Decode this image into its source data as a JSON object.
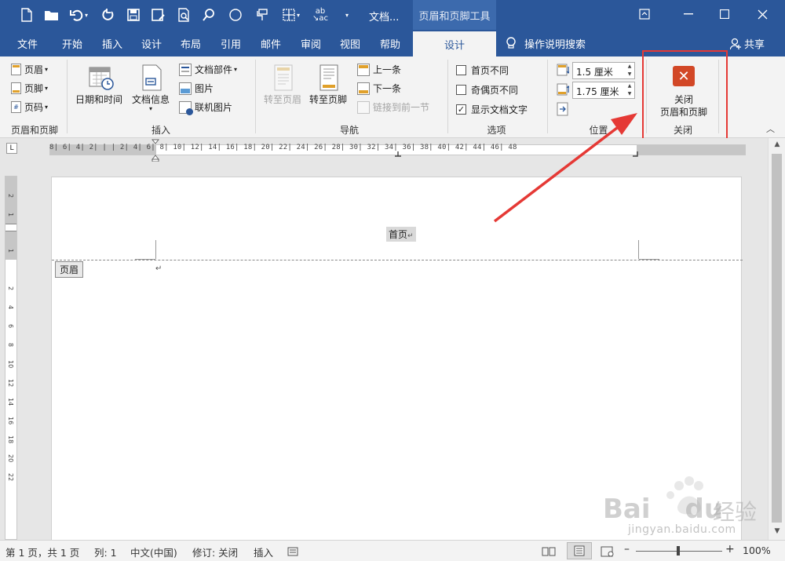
{
  "titlebar": {
    "doc_title": "文档...",
    "tools_title": "页眉和页脚工具",
    "qat_icons": [
      "new-doc-icon",
      "open-icon",
      "undo-icon",
      "redo-icon",
      "save-icon",
      "save-as-icon",
      "print-preview-icon",
      "find-icon",
      "shape-icon",
      "format-painter-icon",
      "table-icon",
      "spelling-icon",
      "customize-icon"
    ]
  },
  "tabs": {
    "items": [
      "文件",
      "开始",
      "插入",
      "设计",
      "布局",
      "引用",
      "邮件",
      "审阅",
      "视图",
      "帮助"
    ],
    "active": "设计",
    "tellme": "操作说明搜索",
    "share": "共享"
  },
  "ribbon": {
    "hf_group": {
      "header": "页眉",
      "footer": "页脚",
      "page_number": "页码",
      "label": "页眉和页脚"
    },
    "insert_group": {
      "date_time": "日期和时间",
      "doc_info": "文档信息",
      "quick_parts": "文档部件",
      "pictures": "图片",
      "online_pictures": "联机图片",
      "label": "插入"
    },
    "nav_group": {
      "goto_header": "转至页眉",
      "goto_footer": "转至页脚",
      "previous": "上一条",
      "next": "下一条",
      "link_previous": "链接到前一节",
      "label": "导航"
    },
    "options_group": {
      "different_first": "首页不同",
      "different_odd_even": "奇偶页不同",
      "show_doc_text": "显示文档文字",
      "label": "选项"
    },
    "position_group": {
      "header_from_top": "1.5 厘米",
      "footer_from_bottom": "1.75 厘米",
      "label": "位置"
    },
    "close_group": {
      "close_line1": "关闭",
      "close_line2": "页眉和页脚",
      "label": "关闭"
    }
  },
  "ruler": {
    "labels": "8| 6| 4| 2| |  | 2| 4| 6| 8| 10| 12| 14| 16| 18| 20| 22| 24| 26| 28| 30| 32| 34| 36| 38| 40| 42| 44| 46| 48",
    "vertical_labels": [
      "2",
      "1",
      "1",
      "2",
      "4",
      "6",
      "8",
      "10",
      "12",
      "14",
      "16",
      "18",
      "20",
      "22"
    ]
  },
  "document": {
    "first_page_header_label": "首页",
    "header_tag": "页眉"
  },
  "statusbar": {
    "page": "第 1 页，共 1 页",
    "column": "列: 1",
    "language": "中文(中国)",
    "track_changes": "修订: 关闭",
    "mode": "插入",
    "zoom": "100%"
  },
  "watermark": {
    "brand": "Bai",
    "brand2": "du",
    "cn": "经验",
    "url": "jingyan.baidu.com"
  }
}
